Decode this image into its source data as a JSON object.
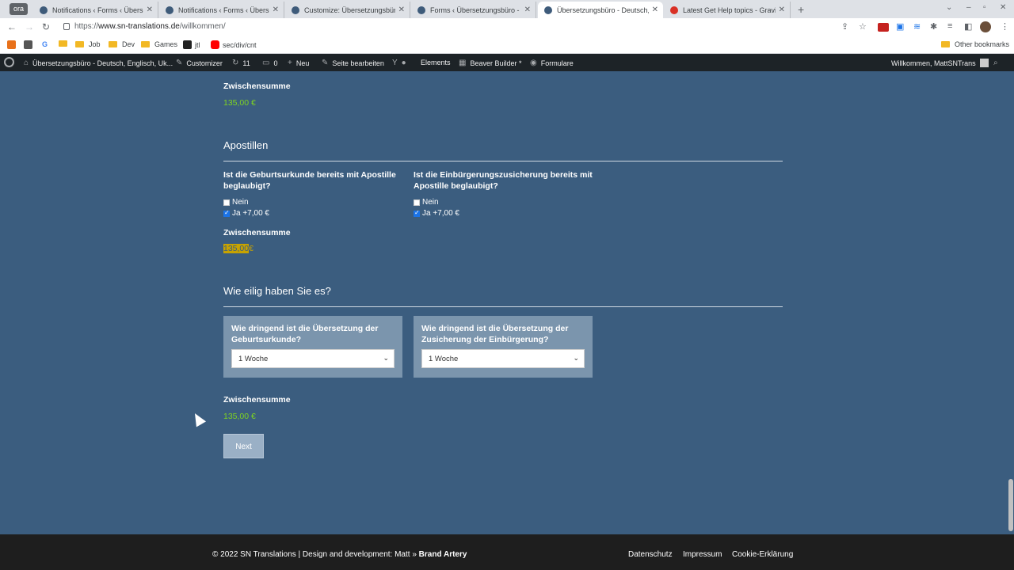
{
  "browser": {
    "profile_label": "ora",
    "tabs": [
      {
        "title": "Notifications ‹ Forms ‹ Überse",
        "active": false
      },
      {
        "title": "Notifications ‹ Forms ‹ Überse",
        "active": false
      },
      {
        "title": "Customize: Übersetzungsbüro",
        "active": false
      },
      {
        "title": "Forms ‹ Übersetzungsbüro - D",
        "active": false
      },
      {
        "title": "Übersetzungsbüro - Deutsch, E",
        "active": true
      },
      {
        "title": "Latest Get Help topics - Gravi",
        "active": false
      }
    ],
    "url_scheme": "https://",
    "url_host": "www.sn-translations.de",
    "url_path": "/willkommen/",
    "bookmarks": [
      "G",
      "Job",
      "Dev",
      "Games",
      "jtl",
      "sec/div/cnt"
    ],
    "other_bookmarks": "Other bookmarks"
  },
  "wp_admin_bar": {
    "site": "Übersetzungsbüro - Deutsch, Englisch, Uk...",
    "customizer": "Customizer",
    "updates": "11",
    "comments": "0",
    "new": "Neu",
    "edit_page": "Seite bearbeiten",
    "elements": "Elements",
    "beaver": "Beaver Builder *",
    "forms": "Formulare",
    "welcome": "Willkommen, MattSNTrans"
  },
  "form": {
    "subtotal1": {
      "label": "Zwischensumme",
      "value": "135,00 €"
    },
    "apostille": {
      "heading": "Apostillen",
      "q1": "Ist die Geburtsurkunde bereits mit Apostille beglaubigt?",
      "q2": "Ist die Einbürgerungszusicherung bereits mit Apostille beglaubigt?",
      "no": "Nein",
      "yes": "Ja +7,00 €",
      "q1_yes_checked": true,
      "q2_yes_checked": true
    },
    "subtotal2": {
      "label": "Zwischensumme",
      "value_num": "135,00",
      "value_cur": "€"
    },
    "urgency": {
      "heading": "Wie eilig haben Sie es?",
      "q1": "Wie dringend ist die Übersetzung der Geburtsurkunde?",
      "q2": "Wie dringend ist die Übersetzung der Zusicherung der Einbürgerung?",
      "sel1": "1 Woche",
      "sel2": "1 Woche"
    },
    "subtotal3": {
      "label": "Zwischensumme",
      "value": "135,00 €"
    },
    "next": "Next"
  },
  "footer": {
    "copyright": "© 2022 SN Translations | Design and development: Matt »",
    "brand": "Brand Artery",
    "links": [
      "Datenschutz",
      "Impressum",
      "Cookie-Erklärung"
    ]
  },
  "colors": {
    "page_bg": "#3b5d7f",
    "price_green": "#7ed321",
    "highlight": "#c8a300",
    "footer_bg": "#1e1e1e"
  }
}
